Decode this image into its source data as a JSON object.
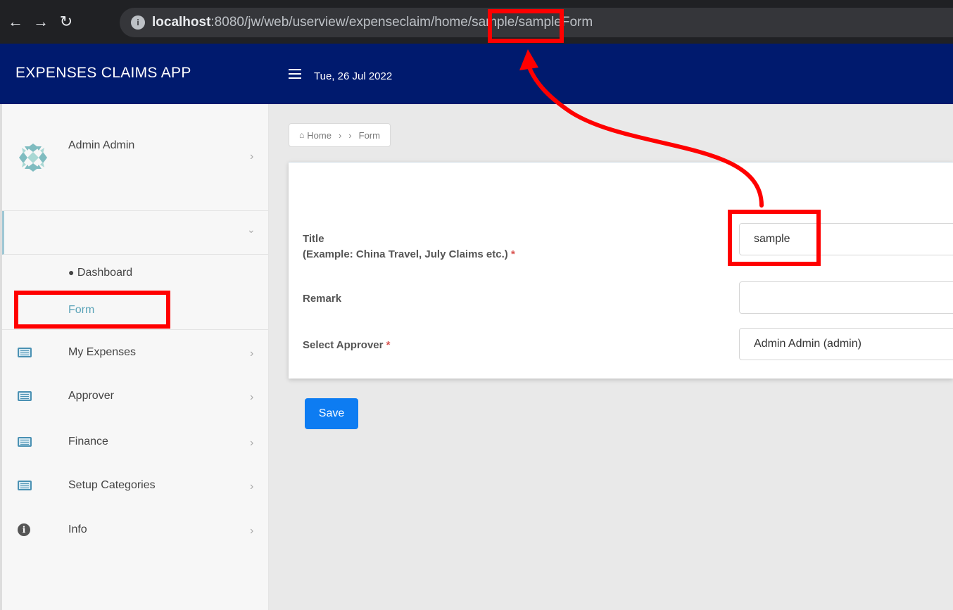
{
  "browser": {
    "url_host": "localhost",
    "url_rest": ":8080/jw/web/userview/expenseclaim/home/sample/sampleForm"
  },
  "header": {
    "brand": "EXPENSES CLAIMS APP",
    "date": "Tue, 26 Jul 2022"
  },
  "sidebar": {
    "profile_name": "Admin Admin",
    "sub_items": [
      {
        "label": "Dashboard",
        "icon": "tachometer-icon"
      },
      {
        "label": "Form"
      }
    ],
    "menu": [
      {
        "label": "My Expenses",
        "icon": "list-icon"
      },
      {
        "label": "Approver",
        "icon": "list-icon"
      },
      {
        "label": "Finance",
        "icon": "list-icon"
      },
      {
        "label": "Setup Categories",
        "icon": "list-icon"
      },
      {
        "label": "Info",
        "icon": "info-icon"
      }
    ]
  },
  "breadcrumb": {
    "home": "Home",
    "current": "Form"
  },
  "form": {
    "title_label": "Title",
    "title_hint": "(Example: China Travel, July Claims etc.)",
    "title_value": "sample",
    "remark_label": "Remark",
    "remark_value": "",
    "approver_label": "Select Approver",
    "approver_value": "Admin Admin (admin)",
    "required_mark": "*",
    "save_label": "Save"
  },
  "colors": {
    "header_bg": "#001a6e",
    "save_button": "#0d7cf2",
    "annotation": "#ff0000",
    "submenu_active": "#5aa3b8"
  }
}
